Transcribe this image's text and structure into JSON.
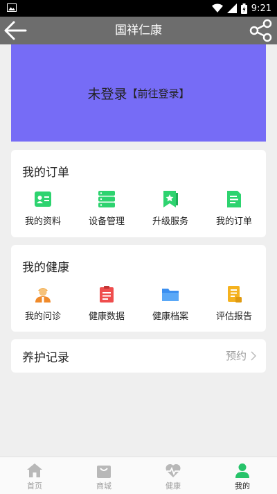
{
  "status_bar": {
    "time": "9:21"
  },
  "app_bar": {
    "title": "国祥仁康"
  },
  "banner": {
    "main_text": "未登录",
    "link_text": "【前往登录】"
  },
  "orders_card": {
    "title": "我的订单",
    "items": [
      {
        "label": "我的资料",
        "icon": "profile-card-icon"
      },
      {
        "label": "设备管理",
        "icon": "server-icon"
      },
      {
        "label": "升级服务",
        "icon": "bookmark-star-icon"
      },
      {
        "label": "我的订单",
        "icon": "document-icon"
      }
    ]
  },
  "health_card": {
    "title": "我的健康",
    "items": [
      {
        "label": "我的问诊",
        "icon": "doctor-icon"
      },
      {
        "label": "健康数据",
        "icon": "clipboard-icon"
      },
      {
        "label": "健康档案",
        "icon": "folder-icon"
      },
      {
        "label": "评估报告",
        "icon": "report-icon"
      }
    ]
  },
  "care_card": {
    "title": "养护记录",
    "action": "预约"
  },
  "tab_bar": {
    "tabs": [
      {
        "label": "首页",
        "icon": "home-icon"
      },
      {
        "label": "商城",
        "icon": "shopping-bag-icon"
      },
      {
        "label": "健康",
        "icon": "heart-pulse-icon"
      },
      {
        "label": "我的",
        "icon": "user-icon"
      }
    ],
    "active_index": 3
  },
  "colors": {
    "app_bar": "#6d6d6d",
    "banner": "#766cf6",
    "accent_green": "#2dd36f",
    "active_tab": "#27c36a",
    "inactive_tab": "#b8b8b8"
  }
}
